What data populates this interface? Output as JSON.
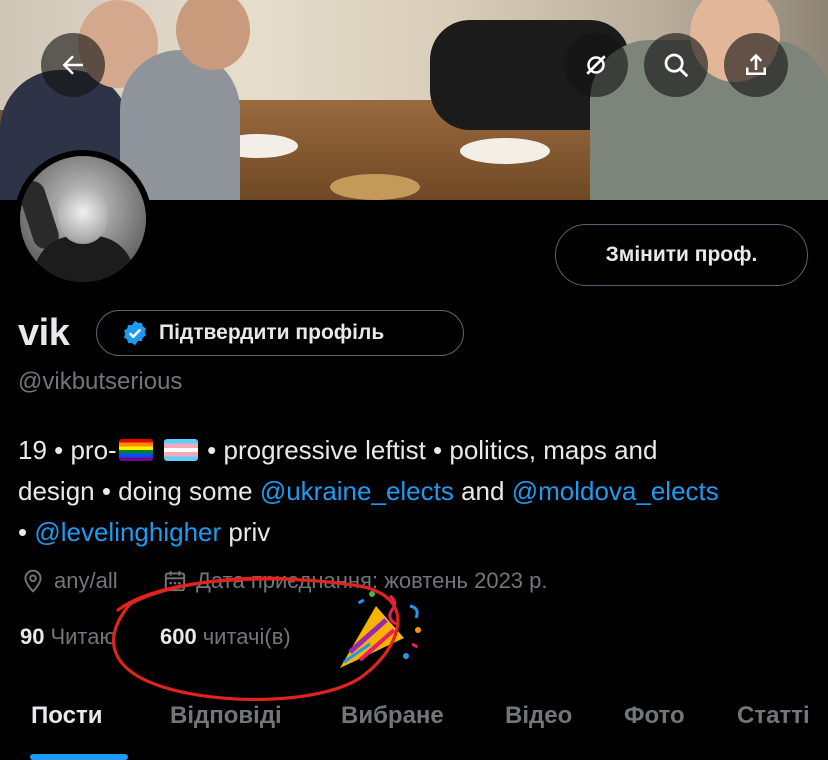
{
  "header": {
    "back_icon": "arrow-left-icon",
    "icons": [
      "grok-icon",
      "search-icon",
      "share-icon"
    ]
  },
  "profile": {
    "edit_button": "Змінити проф.",
    "name": "vik",
    "verify_button": "Підтвердити профіль",
    "handle": "@vikbutserious",
    "bio": {
      "line1_prefix": "19 • pro-",
      "line1_suffix": " • progressive leftist • politics, maps and",
      "line2_prefix": "design • doing some ",
      "mention1": "@ukraine_elects",
      "line2_mid": " and ",
      "mention2": "@moldova_elects",
      "line3_prefix": "• ",
      "mention3": "@levelinghigher",
      "line3_suffix": " priv"
    },
    "location": "any/all",
    "joined": "Дата приєднання: жовтень 2023 р.",
    "following_count": "90",
    "following_label": "Читаю",
    "followers_count": "600",
    "followers_label": "читачі(в)"
  },
  "tabs": [
    "Пости",
    "Відповіді",
    "Вибране",
    "Відео",
    "Фото",
    "Статті"
  ],
  "active_tab": "Пости",
  "colors": {
    "accent": "#1d9bf0",
    "annotation_circle": "#e0231d",
    "muted_text": "#71767b",
    "primary_text": "#e7e9ea"
  }
}
